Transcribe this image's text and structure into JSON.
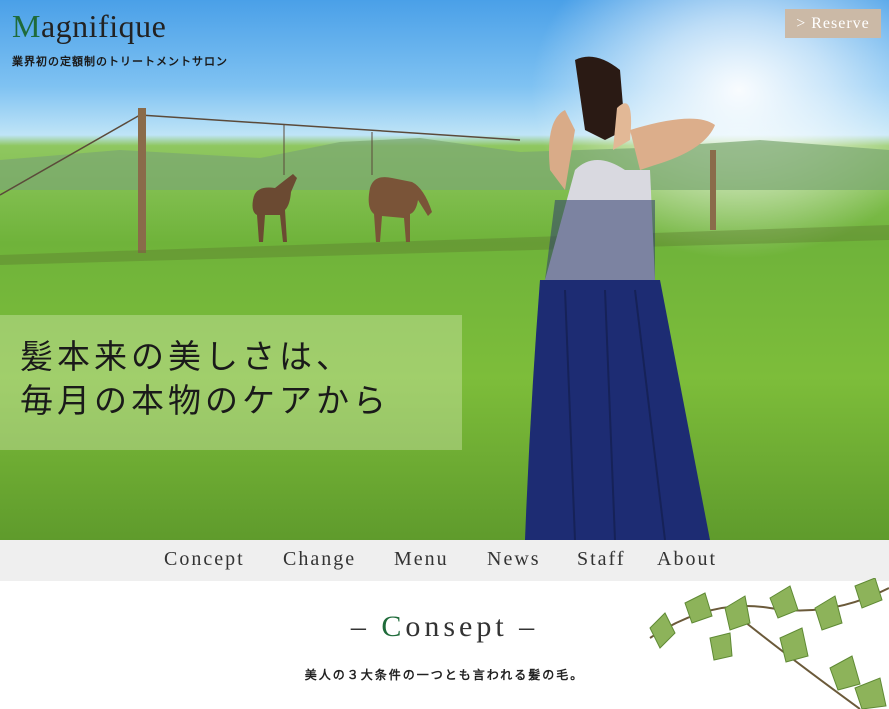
{
  "brand": {
    "logo_initial": "M",
    "logo_rest": "agnifique",
    "tagline": "業界初の定額制のトリートメントサロン",
    "accent_color": "#1f6b3a"
  },
  "header": {
    "reserve_label": "> Reserve",
    "reserve_color": "#cbb9a6"
  },
  "hero": {
    "copy_line1": "髪本来の美しさは、",
    "copy_line2": "毎月の本物のケアから",
    "image_desc_icons": [
      "horse-icon",
      "woman-figure",
      "fence",
      "ivy-leaves-icon"
    ]
  },
  "nav": {
    "items": [
      {
        "label": "Concept"
      },
      {
        "label": "Change"
      },
      {
        "label": "Menu"
      },
      {
        "label": "News"
      },
      {
        "label": "Staff"
      },
      {
        "label": "About"
      }
    ]
  },
  "concept": {
    "dash_left": "–",
    "title_initial": "C",
    "title_rest": "onsept",
    "dash_right": "–",
    "subtitle": "美人の３大条件の一つとも言われる髪の毛。"
  }
}
